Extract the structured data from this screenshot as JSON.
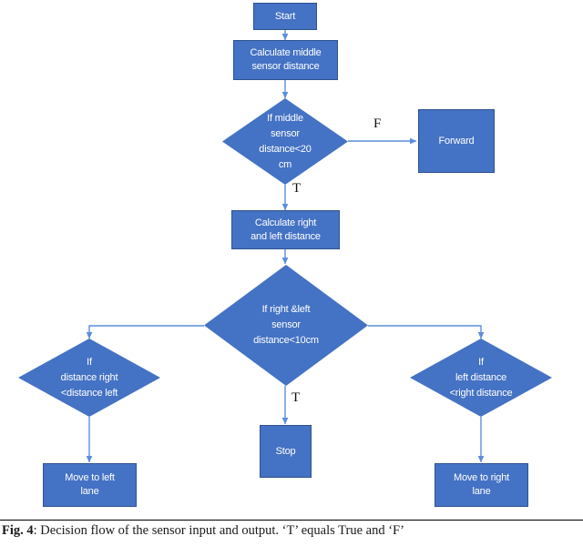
{
  "figure": {
    "colors": {
      "node_fill": "#4472C4",
      "node_border": "#2F528F",
      "connector": "#5B8EDB",
      "text_on_node": "#FFFFFF",
      "caption_text": "#1A1A1A"
    },
    "nodes": [
      {
        "id": "start",
        "type": "terminator",
        "label": "Start"
      },
      {
        "id": "calc_middle",
        "type": "process",
        "label": "Calculate middle\nsensor distance"
      },
      {
        "id": "if_middle",
        "type": "decision",
        "label": "If middle\nsensor\ndistance<20\ncm"
      },
      {
        "id": "forward",
        "type": "process",
        "label": "Forward"
      },
      {
        "id": "calc_rl",
        "type": "process",
        "label": "Calculate right\nand left distance"
      },
      {
        "id": "if_right_left",
        "type": "decision",
        "label": "If right &left\nsensor\ndistance<10cm"
      },
      {
        "id": "if_dist_right",
        "type": "decision",
        "label": "If\ndistance right\n<distance left"
      },
      {
        "id": "if_dist_left",
        "type": "decision",
        "label": "If\nleft distance\n<right distance"
      },
      {
        "id": "stop",
        "type": "terminator",
        "label": "Stop"
      },
      {
        "id": "move_left",
        "type": "process",
        "label": "Move to left\nlane"
      },
      {
        "id": "move_right",
        "type": "process",
        "label": "Move to right\nlane"
      }
    ],
    "edge_labels": [
      {
        "id": "f_middle",
        "text": "F"
      },
      {
        "id": "t_middle",
        "text": "T"
      },
      {
        "id": "t_center",
        "text": "T"
      }
    ]
  },
  "caption": {
    "prefix": "Fig. 4",
    "text": ": Decision flow of the sensor input and output. ‘T’ equals True and ‘F’"
  }
}
